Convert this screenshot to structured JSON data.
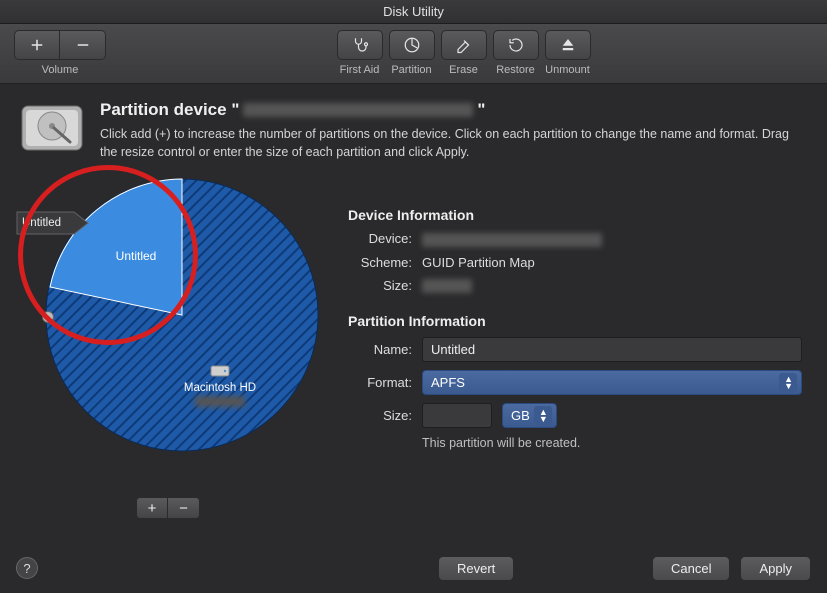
{
  "window": {
    "title": "Disk Utility"
  },
  "toolbar": {
    "volume_label": "Volume",
    "first_aid_label": "First Aid",
    "partition_label": "Partition",
    "erase_label": "Erase",
    "restore_label": "Restore",
    "unmount_label": "Unmount"
  },
  "header": {
    "title_prefix": "Partition device \"",
    "title_suffix": "\"",
    "instructions": "Click add (+) to increase the number of partitions on the device. Click on each partition to change the name and format. Drag the resize control or enter the size of each partition and click Apply."
  },
  "pie": {
    "tag_label": "Untitled",
    "selected_slice_label": "Untitled",
    "main_slice_label": "Macintosh HD",
    "plus": "+",
    "minus": "−"
  },
  "device_info": {
    "heading": "Device Information",
    "device_label": "Device:",
    "scheme_label": "Scheme:",
    "scheme_value": "GUID Partition Map",
    "size_label": "Size:"
  },
  "partition_info": {
    "heading": "Partition Information",
    "name_label": "Name:",
    "name_value": "Untitled",
    "format_label": "Format:",
    "format_value": "APFS",
    "size_label": "Size:",
    "size_unit": "GB",
    "hint": "This partition will be created."
  },
  "footer": {
    "help": "?",
    "revert": "Revert",
    "cancel": "Cancel",
    "apply": "Apply"
  },
  "colors": {
    "accent_blue": "#3b7bd9",
    "annotation_red": "#d81f1f"
  }
}
